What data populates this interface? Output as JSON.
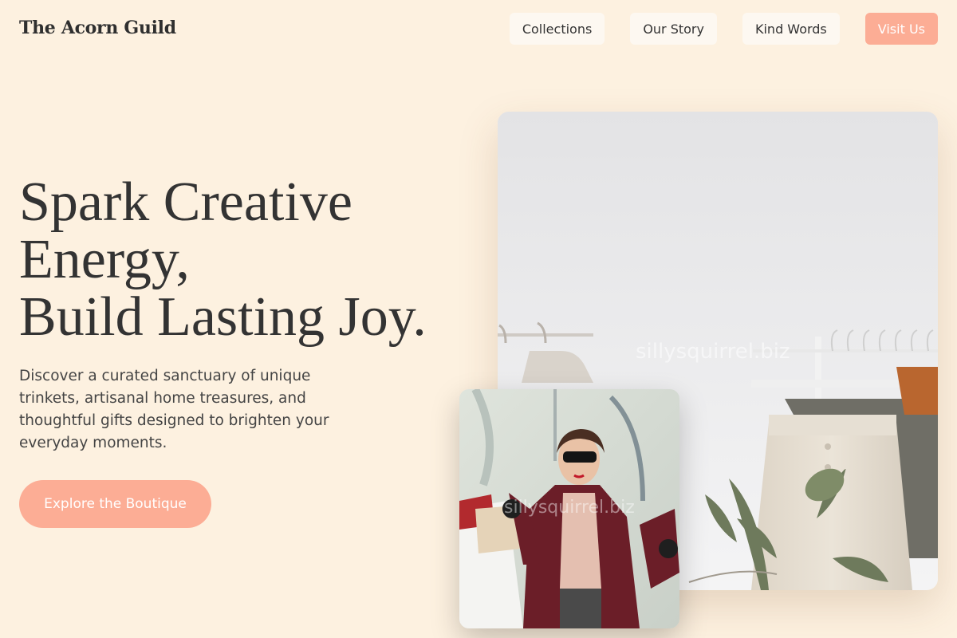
{
  "brand": "The Acorn Guild",
  "nav": {
    "items": [
      "Collections",
      "Our Story",
      "Kind Words"
    ],
    "cta": "Visit Us"
  },
  "hero": {
    "title_lines": [
      "Spark Creative",
      "Energy,",
      "Build Lasting Joy."
    ],
    "subtitle": "Discover a curated sanctuary of unique trinkets, artisanal home treasures, and thoughtful gifts designed to brighten your everyday moments.",
    "button": "Explore the Boutique"
  },
  "images": {
    "main_watermark": "sillysquirrel.biz",
    "small_watermark": "sillysquirrel.biz"
  },
  "colors": {
    "background": "#fdf1e0",
    "accent": "#fcad95",
    "text": "#333333"
  }
}
